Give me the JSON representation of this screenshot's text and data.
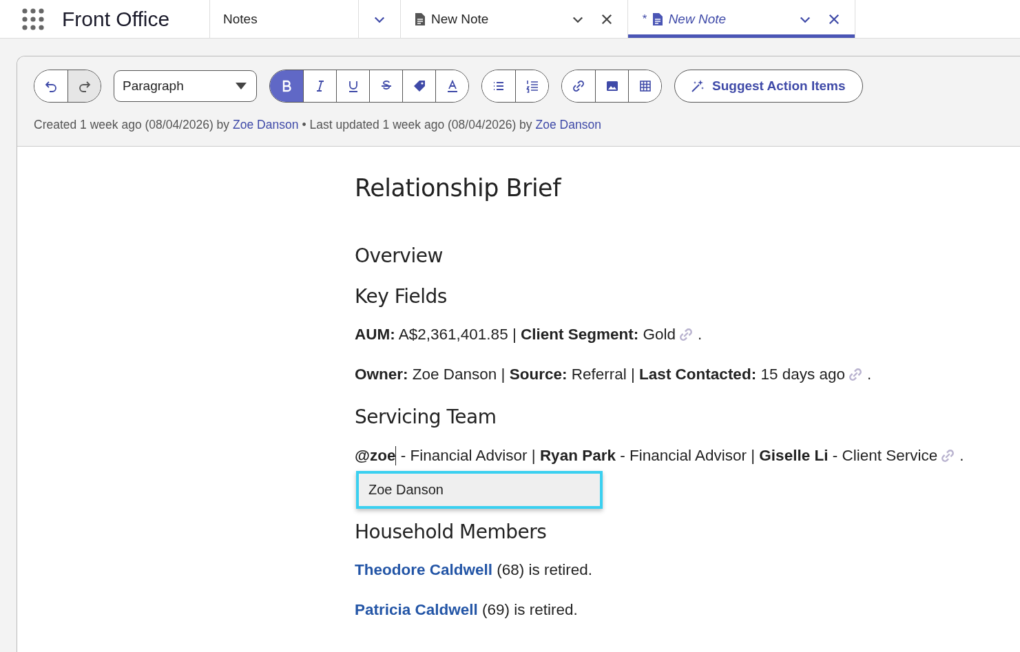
{
  "app": {
    "title": "Front Office"
  },
  "tabs": [
    {
      "kind": "list",
      "label": "Notes",
      "selected": false
    },
    {
      "kind": "note",
      "label": "New Note",
      "selected": false
    },
    {
      "kind": "note",
      "prefix": "*",
      "label": "New Note",
      "selected": true
    }
  ],
  "toolbar": {
    "history": [
      {
        "kind": "undo",
        "on": false
      },
      {
        "kind": "redo",
        "on": true
      }
    ],
    "block_format": "Paragraph",
    "format": [
      {
        "kind": "bold",
        "on": true
      },
      {
        "kind": "italic",
        "on": false
      },
      {
        "kind": "underline",
        "on": false
      },
      {
        "kind": "strike",
        "on": false
      },
      {
        "kind": "tag",
        "on": false
      },
      {
        "kind": "color",
        "on": false
      }
    ],
    "lists": [
      {
        "kind": "bullets",
        "on": false
      },
      {
        "kind": "numbers",
        "on": false
      }
    ],
    "insert": [
      {
        "kind": "link",
        "on": false
      },
      {
        "kind": "image",
        "on": false
      },
      {
        "kind": "table",
        "on": false
      }
    ],
    "suggest": "Suggest Action Items"
  },
  "meta": {
    "created": "Created 1 week ago (08/04/2026) by",
    "created_by": "Zoe Danson",
    "separator": "•",
    "updated": "Last updated 1 week ago (08/04/2026) by",
    "updated_by": "Zoe Danson"
  },
  "document": [
    {
      "kind": "title",
      "text": "Relationship Brief"
    },
    {
      "kind": "heading",
      "text": "Overview"
    },
    {
      "kind": "heading",
      "text": "Key Fields"
    },
    {
      "kind": "paragraph",
      "text": "**AUM:** A$2,361,401.85 | **Client Segment:** Gold",
      "source_icon": true,
      "end": "."
    },
    {
      "kind": "paragraph",
      "text": "**Owner:** Zoe Danson | **Source:** Referral | **Last Contacted:** 15 days ago",
      "source_icon": true,
      "end": "."
    },
    {
      "kind": "heading",
      "text": "Servicing Team"
    },
    {
      "kind": "mention",
      "mention": "@zoe",
      "text": " - Financial Advisor | **Ryan Park** - Financial Advisor | **Giselle Li** - Client Service",
      "source_icon": true,
      "end": ".",
      "suggestions": [
        {
          "label": "Zoe Danson",
          "selected": true
        }
      ]
    },
    {
      "kind": "heading",
      "text": "Household Members"
    },
    {
      "kind": "person",
      "link": "Theodore Caldwell",
      "text": " (68) is retired."
    },
    {
      "kind": "person",
      "link": "Patricia Caldwell",
      "text": " (69) is retired."
    }
  ]
}
